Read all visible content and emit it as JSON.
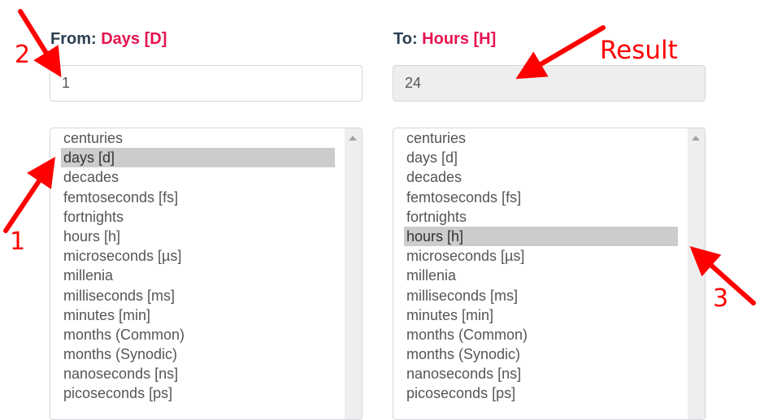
{
  "from": {
    "label_prefix": "From:",
    "unit_label": "Days [D]",
    "input_value": "1",
    "selected_index": 1
  },
  "to": {
    "label_prefix": "To:",
    "unit_label": "Hours [H]",
    "result_value": "24",
    "selected_index": 5
  },
  "units": [
    "centuries",
    "days [d]",
    "decades",
    "femtoseconds [fs]",
    "fortnights",
    "hours [h]",
    "microseconds [µs]",
    "millenia",
    "milliseconds [ms]",
    "minutes [min]",
    "months (Common)",
    "months (Synodic)",
    "nanoseconds [ns]",
    "picoseconds [ps]"
  ],
  "annotations": {
    "step1": "1",
    "step2": "2",
    "step3": "3",
    "result": "Result"
  },
  "colors": {
    "accent": "#e6134f",
    "annotation": "#ff0000",
    "selected_bg": "#cccccc",
    "readonly_bg": "#eeeeee"
  }
}
